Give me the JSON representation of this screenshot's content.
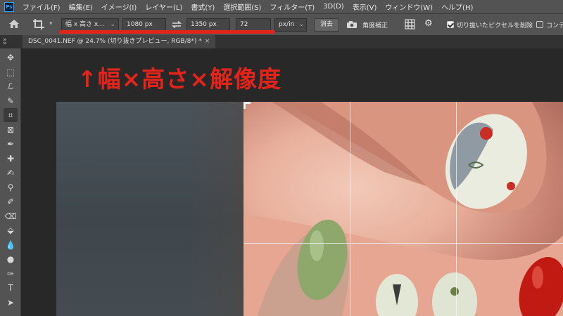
{
  "app": {
    "logo_text": "Ps"
  },
  "menu": {
    "items": [
      "ファイル(F)",
      "編集(E)",
      "イメージ(I)",
      "レイヤー(L)",
      "書式(Y)",
      "選択範囲(S)",
      "フィルター(T)",
      "3D(D)",
      "表示(V)",
      "ウィンドウ(W)",
      "ヘルプ(H)"
    ]
  },
  "options": {
    "preset_label": "幅 x 高さ x...",
    "width_value": "1080 px",
    "height_value": "1350 px",
    "resolution_value": "72",
    "resolution_unit": "px/in",
    "clear_button": "消去",
    "straighten_label": "角度補正",
    "delete_cropped_label": "切り抜いたピクセルを削除",
    "delete_cropped_checked": true,
    "content_aware_label": "コンテン",
    "content_aware_checked": false
  },
  "document": {
    "tab_title": "DSC_0041.NEF @ 24.7% (切り抜きプレビュー, RGB/8*) *",
    "close_glyph": "×"
  },
  "annotation": {
    "text": "↑幅×高さ×解像度",
    "color": "#e3241b"
  },
  "toolbar": {
    "collapse_glyph": "»",
    "tools": [
      {
        "name": "move-tool",
        "glyph": "✥"
      },
      {
        "name": "marquee-tool",
        "glyph": "⬚"
      },
      {
        "name": "lasso-tool",
        "glyph": "ℒ"
      },
      {
        "name": "quick-select-tool",
        "glyph": "✎"
      },
      {
        "name": "crop-tool",
        "glyph": "⌗"
      },
      {
        "name": "frame-tool",
        "glyph": "⊠"
      },
      {
        "name": "eyedropper-tool",
        "glyph": "✒"
      },
      {
        "name": "healing-tool",
        "glyph": "✚"
      },
      {
        "name": "brush-tool",
        "glyph": "✍"
      },
      {
        "name": "stamp-tool",
        "glyph": "⚲"
      },
      {
        "name": "history-brush-tool",
        "glyph": "✐"
      },
      {
        "name": "eraser-tool",
        "glyph": "⌫"
      },
      {
        "name": "bucket-tool",
        "glyph": "⬙"
      },
      {
        "name": "blur-tool",
        "glyph": "💧"
      },
      {
        "name": "dodge-tool",
        "glyph": "●"
      },
      {
        "name": "pen-tool",
        "glyph": "✑"
      },
      {
        "name": "type-tool",
        "glyph": "T"
      },
      {
        "name": "path-select-tool",
        "glyph": "➤"
      }
    ]
  }
}
